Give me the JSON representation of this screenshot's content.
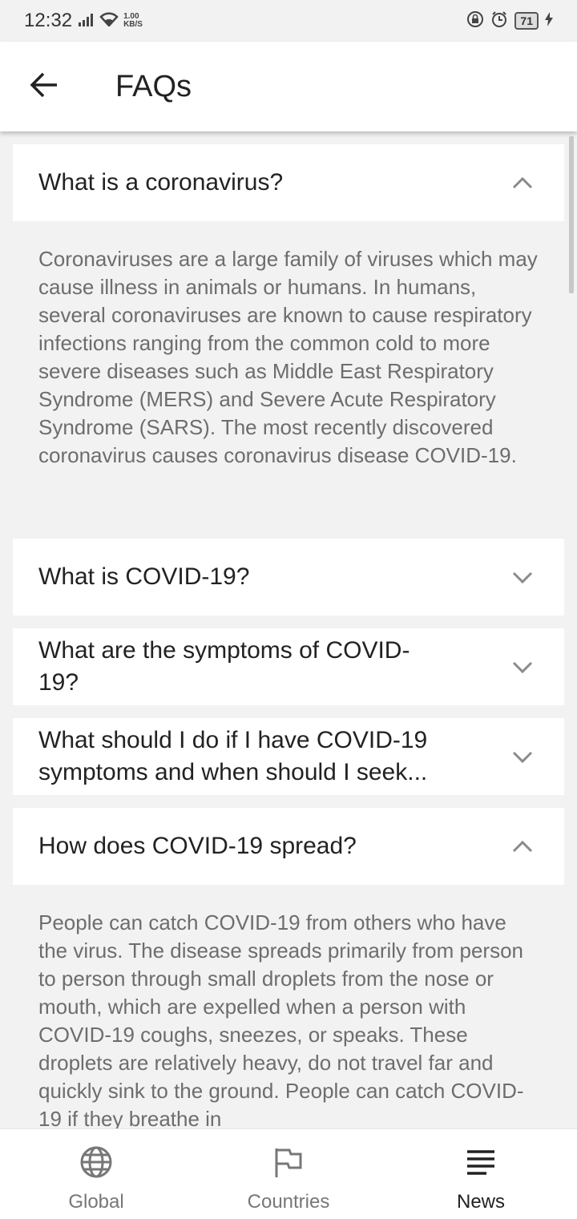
{
  "status_bar": {
    "time": "12:32",
    "speed_value": "1.00",
    "speed_unit": "KB/S",
    "battery": "71"
  },
  "header": {
    "title": "FAQs"
  },
  "faqs": [
    {
      "question": "What is a coronavirus?",
      "expanded": true,
      "answer": "Coronaviruses are a large family of viruses which may cause illness in animals or humans.  In humans, several coronaviruses are known to cause respiratory infections ranging from the common cold to more severe diseases such as Middle East Respiratory Syndrome (MERS) and Severe Acute Respiratory Syndrome (SARS). The most recently discovered coronavirus causes coronavirus disease COVID-19."
    },
    {
      "question": "What is COVID-19?",
      "expanded": false
    },
    {
      "question": "What are the symptoms of COVID-19?",
      "expanded": false
    },
    {
      "question": "What should I do if I have COVID-19 symptoms and when should I seek...",
      "expanded": false
    },
    {
      "question": "How does COVID-19 spread?",
      "expanded": true,
      "answer": "People can catch COVID-19 from others who have the virus. The disease spreads primarily from person to person through small droplets from the nose or mouth, which are expelled when a person with COVID-19 coughs, sneezes, or speaks. These droplets are relatively heavy, do not travel far and quickly sink to the ground. People can catch COVID-19 if they breathe in"
    }
  ],
  "bottom_nav": {
    "items": [
      {
        "label": "Global",
        "icon": "globe-icon",
        "active": false
      },
      {
        "label": "Countries",
        "icon": "flag-icon",
        "active": false
      },
      {
        "label": "News",
        "icon": "menu-icon",
        "active": true
      }
    ]
  }
}
